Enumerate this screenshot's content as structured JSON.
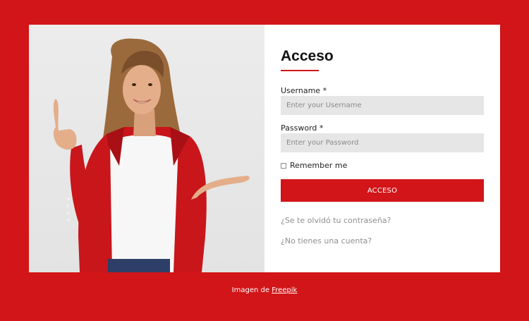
{
  "form": {
    "title": "Acceso",
    "username_label": "Username *",
    "username_placeholder": "Enter your Username",
    "password_label": "Password *",
    "password_placeholder": "Enter your Password",
    "remember_label": "Remember me",
    "submit_label": "ACCESO",
    "forgot_link": "¿Se te olvidó tu contraseña?",
    "signup_link": "¿No tienes una cuenta?"
  },
  "footer": {
    "prefix": "Imagen de",
    "link": "Freepik"
  },
  "colors": {
    "accent": "#d21518",
    "field_bg": "#e6e6e6"
  }
}
